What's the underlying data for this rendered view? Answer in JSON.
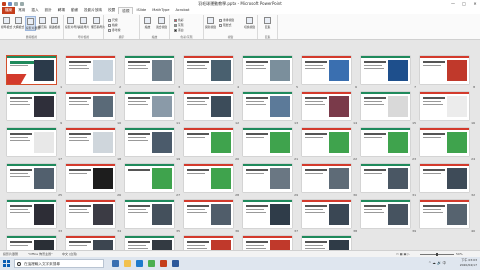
{
  "window": {
    "title": "羽毛球運動教學.pptx - Microsoft PowerPoint",
    "controls": [
      "—",
      "□",
      "✕"
    ]
  },
  "tabs": [
    "檔案",
    "常用",
    "插入",
    "設計",
    "轉場",
    "動畫",
    "投影片放映",
    "校閱",
    "檢視",
    "iSlide",
    "MathType",
    "Acrobat"
  ],
  "ribbon": {
    "groups": [
      {
        "name": "簡報檢視",
        "buttons": [
          "標準模式",
          "大綱模式",
          "投影片瀏覽",
          "備忘稿",
          "閱讀檢視"
        ]
      },
      {
        "name": "母片檢視",
        "buttons": [
          "投影片母片",
          "講義母片",
          "備忘稿母片"
        ]
      },
      {
        "name": "顯示",
        "options": [
          "尺規",
          "格線",
          "參考線"
        ]
      },
      {
        "name": "縮放",
        "buttons": [
          "縮放",
          "適合視窗"
        ]
      },
      {
        "name": "色彩/灰階",
        "options": [
          "色彩",
          "灰階",
          "黑白"
        ]
      },
      {
        "name": "視窗",
        "buttons": [
          "開新視窗",
          "重排視窗",
          "階層式",
          "切換視窗"
        ]
      },
      {
        "name": "巨集",
        "buttons": [
          "巨集"
        ]
      }
    ]
  },
  "slides": {
    "numbers": [
      "1",
      "2",
      "3",
      "4",
      "5",
      "6",
      "7",
      "8",
      "9",
      "10",
      "11",
      "12",
      "13",
      "14",
      "15",
      "16",
      "17",
      "18",
      "19",
      "20",
      "21",
      "22",
      "23",
      "24",
      "25",
      "26",
      "27",
      "28",
      "29",
      "30",
      "31",
      "32",
      "33",
      "34",
      "35",
      "36",
      "37",
      "38",
      "39",
      "40",
      "41",
      "42",
      "43",
      "44",
      "45",
      "46",
      "47",
      "48"
    ]
  },
  "status": {
    "view": "投影片瀏覽",
    "theme": "\"Office 佈景主題\"",
    "language": "中文 (台灣)",
    "zoom": "50%"
  },
  "taskbar": {
    "search_placeholder": "在這裡輸入文字來搜尋",
    "time": "下午 03:03",
    "date": "2020/04/17",
    "tray": "^ ☁ 🔊 中"
  },
  "colors": {
    "accent_red": "#d33a2c",
    "accent_green": "#1f8a5c",
    "file_tab": "#c43e1c",
    "selection": "#d34e2b"
  }
}
